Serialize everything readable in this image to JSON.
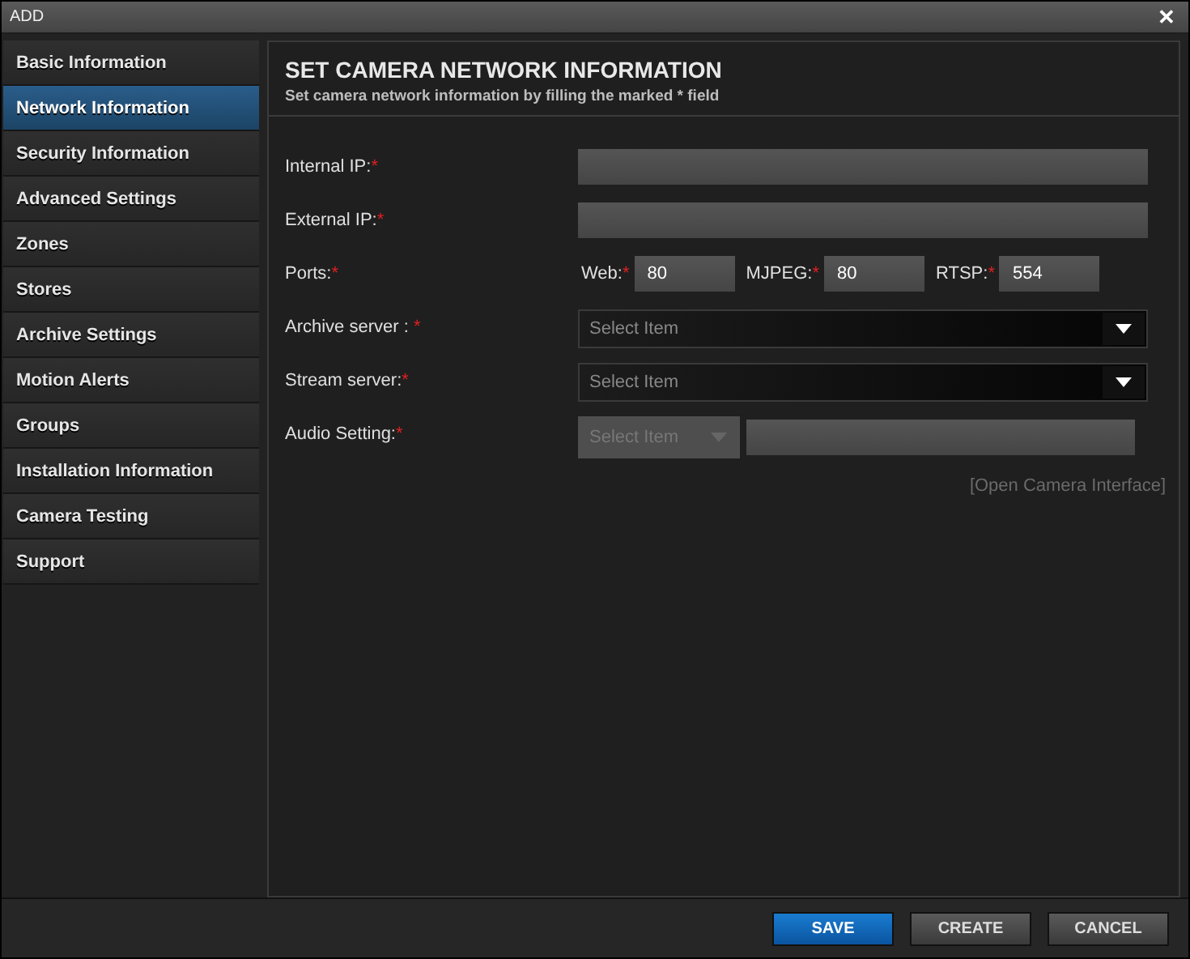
{
  "window": {
    "title": "ADD",
    "close": "✕"
  },
  "sidebar": {
    "items": [
      {
        "label": "Basic Information",
        "selected": false
      },
      {
        "label": "Network Information",
        "selected": true
      },
      {
        "label": "Security Information",
        "selected": false
      },
      {
        "label": "Advanced Settings",
        "selected": false
      },
      {
        "label": "Zones",
        "selected": false
      },
      {
        "label": "Stores",
        "selected": false
      },
      {
        "label": "Archive Settings",
        "selected": false
      },
      {
        "label": "Motion Alerts",
        "selected": false
      },
      {
        "label": "Groups",
        "selected": false
      },
      {
        "label": "Installation Information",
        "selected": false
      },
      {
        "label": "Camera Testing",
        "selected": false
      },
      {
        "label": "Support",
        "selected": false
      }
    ]
  },
  "header": {
    "title": "SET CAMERA NETWORK INFORMATION",
    "subtitle": "Set camera network information by filling the marked * field"
  },
  "fields": [
    {
      "kind": "text",
      "label": "Internal IP:",
      "mark": "*"
    },
    {
      "kind": "text",
      "label": "External IP:",
      "mark": "*"
    },
    {
      "kind": "ports",
      "label": "Ports:",
      "mark": "*",
      "ports": [
        {
          "label": "Web:",
          "mark": "*",
          "value": "80"
        },
        {
          "label": "MJPEG:",
          "mark": "*",
          "value": "80"
        },
        {
          "label": "RTSP:",
          "mark": "*",
          "value": "554"
        }
      ]
    },
    {
      "kind": "select",
      "label": "Archive server : ",
      "mark": "*",
      "placeholder": "Select Item"
    },
    {
      "kind": "select",
      "label": "Stream server:",
      "mark": "*",
      "placeholder": "Select Item"
    },
    {
      "kind": "audio",
      "label": "Audio Setting:",
      "mark": "*",
      "placeholder": "Select Item",
      "disabled": true
    }
  ],
  "link": "[Open Camera Interface]",
  "buttons": [
    {
      "label": "SAVE",
      "kind": "primary"
    },
    {
      "label": "CREATE",
      "kind": "secondary"
    },
    {
      "label": "CANCEL",
      "kind": "secondary"
    }
  ]
}
